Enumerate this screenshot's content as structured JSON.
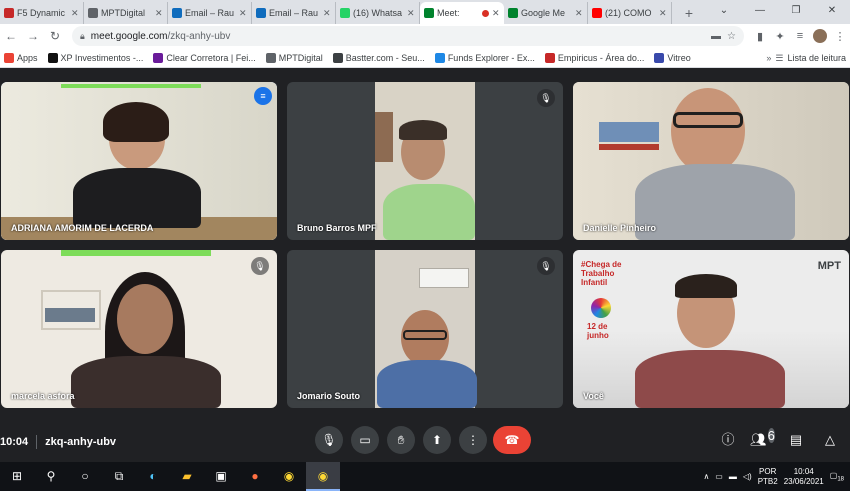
{
  "browser": {
    "tabs": [
      {
        "label": "F5 Dynamic",
        "icon": "f5-icon",
        "color": "#c62828",
        "active": false
      },
      {
        "label": "MPTDigital",
        "icon": "page-icon",
        "color": "#5f6368",
        "active": false
      },
      {
        "label": "Email – Rau",
        "icon": "outlook-icon",
        "color": "#0f6cbd",
        "active": false
      },
      {
        "label": "Email – Rau",
        "icon": "outlook-icon",
        "color": "#0f6cbd",
        "active": false
      },
      {
        "label": "(16) Whatsa",
        "icon": "whatsapp-icon",
        "color": "#25d366",
        "active": false
      },
      {
        "label": "Meet: ",
        "icon": "meet-icon",
        "color": "#00832d",
        "active": true
      },
      {
        "label": "Google Me",
        "icon": "meet-icon",
        "color": "#00832d",
        "active": false
      },
      {
        "label": "(21) COMO",
        "icon": "youtube-icon",
        "color": "#ff0000",
        "active": false
      }
    ],
    "url_host": "meet.google.com",
    "url_path": "/zkq-anhy-ubv",
    "bookmarks": [
      {
        "label": "Apps",
        "color": "#ea4335"
      },
      {
        "label": "XP Investimentos -...",
        "color": "#111111"
      },
      {
        "label": "Clear Corretora | Fei...",
        "color": "#6a1b9a"
      },
      {
        "label": "MPTDigital",
        "color": "#5f6368"
      },
      {
        "label": "Bastter.com - Seu...",
        "color": "#3c4043"
      },
      {
        "label": "Funds Explorer - Ex...",
        "color": "#1e88e5"
      },
      {
        "label": "Empiricus - Área do...",
        "color": "#c62828"
      },
      {
        "label": "Vitreo",
        "color": "#3949ab"
      }
    ],
    "reading_list": "Lista de leitura"
  },
  "meeting": {
    "participants": [
      {
        "name": "ADRIANA AMORIM DE LACERDA",
        "speaking": true,
        "muted": false
      },
      {
        "name": "Bruno Barros MPF",
        "speaking": false,
        "muted": true
      },
      {
        "name": "Danielle Pinheiro",
        "speaking": false,
        "muted": false
      },
      {
        "name": "marcela asfora",
        "speaking": false,
        "muted": true
      },
      {
        "name": "Jomario Souto",
        "speaking": false,
        "muted": true
      },
      {
        "name": "Você",
        "speaking": false,
        "muted": false
      }
    ],
    "background_text": {
      "campaign": "#Chega de Trabalho Infantil",
      "date": "12 de junho",
      "org": "MPT"
    },
    "time": "10:04",
    "code": "zkq-anhy-ubv",
    "people_count": "6"
  },
  "taskbar": {
    "lang_top": "POR",
    "lang_bottom": "PTB2",
    "clock_time": "10:04",
    "clock_date": "23/06/2021",
    "notif_count": "18"
  }
}
